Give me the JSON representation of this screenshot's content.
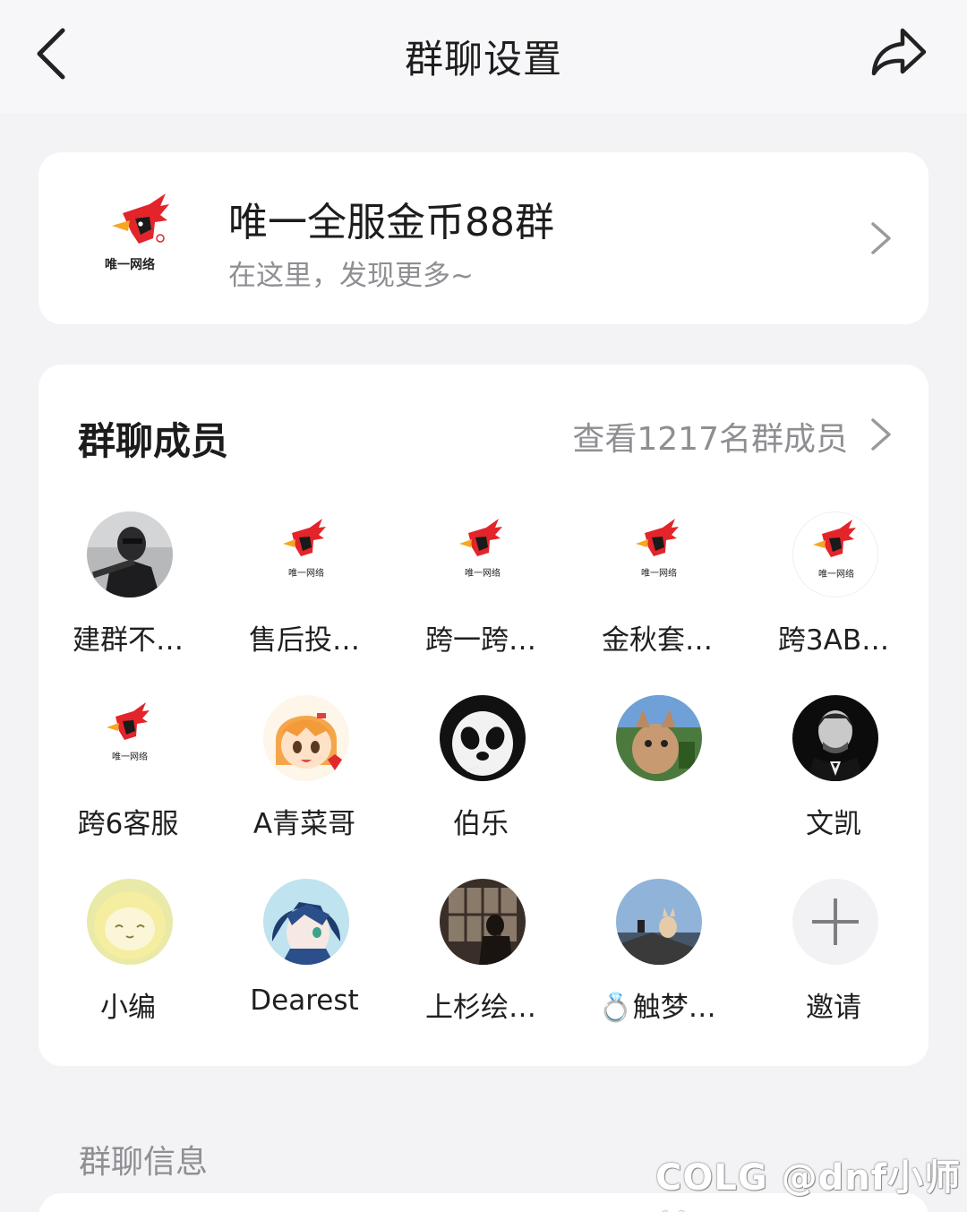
{
  "header": {
    "title": "群聊设置",
    "back_icon": "chevron-left-icon",
    "share_icon": "share-arrow-icon"
  },
  "group": {
    "name": "唯一全服金币88群",
    "subtitle": "在这里，发现更多~",
    "logo_text": "唯一网络"
  },
  "members": {
    "title": "群聊成员",
    "view_all": "查看1217名群成员",
    "items": [
      {
        "name": "建群不…",
        "avatar": "masked-person"
      },
      {
        "name": "售后投…",
        "avatar": "logo"
      },
      {
        "name": "跨一跨…",
        "avatar": "logo"
      },
      {
        "name": "金秋套…",
        "avatar": "logo"
      },
      {
        "name": "跨3AB…",
        "avatar": "logo"
      },
      {
        "name": "跨6客服",
        "avatar": "logo"
      },
      {
        "name": "A青菜哥",
        "avatar": "anime-girl"
      },
      {
        "name": "伯乐",
        "avatar": "panda"
      },
      {
        "name": "",
        "avatar": "cat"
      },
      {
        "name": "文凯",
        "avatar": "man-bw"
      },
      {
        "name": "小编",
        "avatar": "yellow-cartoon"
      },
      {
        "name": "Dearest",
        "avatar": "anime-blue"
      },
      {
        "name": "上杉绘…",
        "avatar": "window-silhouette"
      },
      {
        "name": "💍触梦…",
        "avatar": "cat-sea"
      },
      {
        "name": "邀请",
        "avatar": "invite"
      }
    ]
  },
  "info_section": {
    "title": "群聊信息"
  },
  "watermark": "COLG @dnf小师弟"
}
